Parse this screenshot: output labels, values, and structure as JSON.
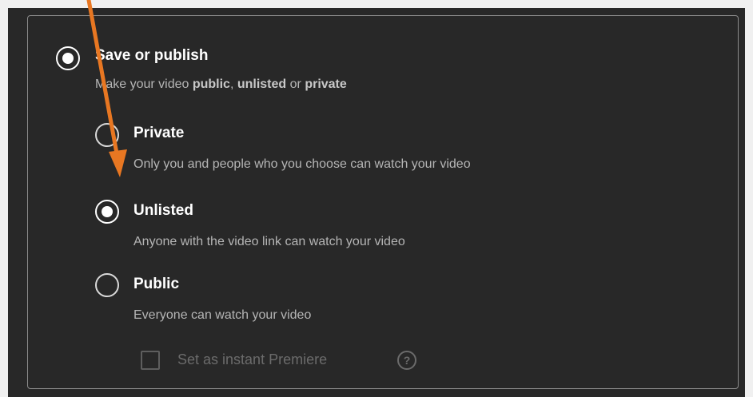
{
  "visibility": {
    "save_or_publish": {
      "title": "Save or publish",
      "desc_prefix": "Make your video ",
      "public_word": "public",
      "sep1": ", ",
      "unlisted_word": "unlisted",
      "sep2": " or ",
      "private_word": "private",
      "selected": true
    },
    "options": {
      "private": {
        "label": "Private",
        "description": "Only you and people who you choose can watch your video",
        "selected": false
      },
      "unlisted": {
        "label": "Unlisted",
        "description": "Anyone with the video link can watch your video",
        "selected": true
      },
      "public": {
        "label": "Public",
        "description": "Everyone can watch your video",
        "selected": false
      }
    },
    "instant_premiere": {
      "label": "Set as instant Premiere",
      "checked": false,
      "enabled": false,
      "help_glyph": "?"
    }
  },
  "annotation": {
    "arrow_color": "#e87722"
  },
  "icons": [
    "radio-button",
    "checkbox",
    "help-icon",
    "annotation-arrow"
  ],
  "colors": {
    "background": "#282828",
    "border": "#8a8a8a",
    "text_primary": "#ffffff",
    "text_secondary": "#b5b5b5",
    "text_disabled": "#6b6b6b"
  }
}
